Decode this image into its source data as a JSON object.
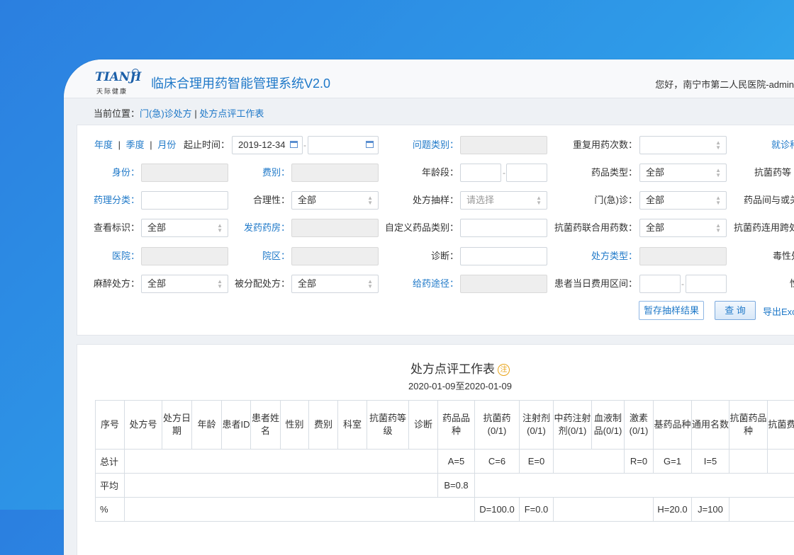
{
  "header": {
    "logo_text": "TIANJI",
    "logo_subtitle": "天际健康",
    "app_title": "临床合理用药智能管理系统V2.0",
    "greeting": "您好，南宁市第二人民医院-admin"
  },
  "breadcrumb": {
    "prefix": "当前位置：",
    "item1": "门(急)诊处方",
    "separator": "|",
    "item2": "处方点评工作表"
  },
  "filters": {
    "period_year": "年度",
    "sep": "|",
    "period_quarter": "季度",
    "period_month": "月份",
    "date_range_label": "起止时间：",
    "date_start": "2019-12-34",
    "range_dash": "-",
    "problem_type_label": "问题类别：",
    "repeat_count_label": "重复用药次数：",
    "visit_label_partial": "就诊种",
    "identity_label": "身份：",
    "fee_type_label": "费别：",
    "age_group_label": "年龄段：",
    "drug_type_label": "药品类型：",
    "drug_type_value": "全部",
    "antibacterial_label_partial": "抗菌药等",
    "pharm_class_label": "药理分类：",
    "rationality_label": "合理性：",
    "rationality_value": "全部",
    "sampling_label": "处方抽样：",
    "sampling_placeholder": "请选择",
    "outpatient_label": "门(急)诊：",
    "outpatient_value": "全部",
    "drug_interaction_label_partial": "药品间与或关",
    "view_flag_label": "查看标识：",
    "view_flag_value": "全部",
    "dispensing_label": "发药药房：",
    "custom_category_label": "自定义药品类别：",
    "combo_count_label": "抗菌药联合用药数：",
    "combo_count_value": "全部",
    "cross_label_partial": "抗菌药连用跨处",
    "hospital_label": "医院：",
    "campus_label": "院区：",
    "diagnosis_label": "诊断：",
    "rx_type_label": "处方类型：",
    "toxic_label_partial": "毒性处",
    "narcotic_label": "麻醉处方：",
    "narcotic_value": "全部",
    "assigned_label": "被分配处方：",
    "assigned_value": "全部",
    "route_label": "给药途径：",
    "daily_cost_label": "患者当日费用区间：",
    "gender_label_partial": "性"
  },
  "actions": {
    "save_sample": "暂存抽样结果",
    "query": "查 询",
    "export_partial": "导出Exc"
  },
  "report": {
    "title": "处方点评工作表",
    "note_icon": "注",
    "date_range": "2020-01-09至2020-01-09",
    "columns": [
      "序号",
      "处方号",
      "处方日期",
      "年龄",
      "患者ID",
      "患者姓名",
      "性别",
      "费别",
      "科室",
      "抗菌药等级",
      "诊断",
      "药品品种",
      "抗菌药(0/1)",
      "注射剂(0/1)",
      "中药注射剂(0/1)",
      "血液制品(0/1)",
      "激素(0/1)",
      "基药品种",
      "通用名数",
      "抗菌药品种",
      "抗菌费("
    ],
    "rows": [
      {
        "label": "总计",
        "a": "A=5",
        "c": "C=6",
        "e": "E=0",
        "r": "R=0",
        "g": "G=1",
        "i": "I=5"
      },
      {
        "label": "平均",
        "b": "B=0.8"
      },
      {
        "label": "%",
        "d": "D=100.0",
        "f": "F=0.0",
        "h": "H=20.0",
        "j": "J=100"
      }
    ]
  },
  "colors": {
    "brand_blue": "#1e78c8",
    "background_gradient_start": "#2b7fe0",
    "background_gradient_end": "#3dc1f2",
    "note_orange": "#e8a317"
  }
}
